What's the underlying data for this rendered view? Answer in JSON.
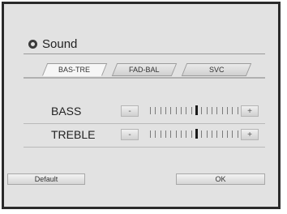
{
  "window": {
    "title": "Sound",
    "icon": "settings-dot-icon"
  },
  "tabs": [
    {
      "label": "BAS-TRE",
      "active": true
    },
    {
      "label": "FAD-BAL",
      "active": false
    },
    {
      "label": "SVC",
      "active": false
    }
  ],
  "controls": [
    {
      "label": "BASS",
      "minus": "-",
      "plus": "+",
      "level": 0
    },
    {
      "label": "TREBLE",
      "minus": "-",
      "plus": "+",
      "level": 0
    }
  ],
  "footer": {
    "default_label": "Default",
    "ok_label": "OK"
  }
}
